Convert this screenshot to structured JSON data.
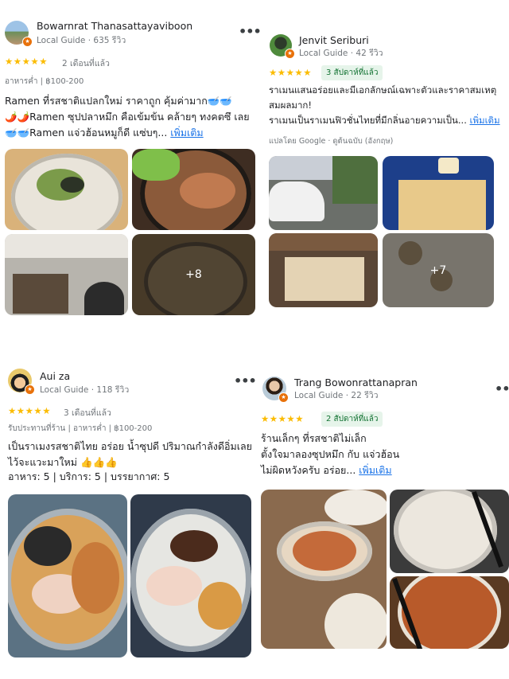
{
  "reviews": [
    {
      "name": "Bowarnrat Thanasattayaviboon",
      "guide": "Local Guide · 635 รีวิว",
      "when": "2 เดือนที่แล้ว",
      "meta": "อาหารค่ำ  |  ฿100-200",
      "lines": [
        "Ramen ที่รสชาติแปลกใหม่ ราคาถูก คุ้มค่ามาก🥣🥣",
        "🌶️🌶️Ramen ซุปปลาหมึก คือเข้มข้น คล้ายๆ ทงคตซึ เลย",
        "🥣🥣Ramen แจ่วฮ้อนหมูก็ดี แซ่บๆ..."
      ],
      "more": "เพิ่มเติม",
      "photo_count": "+8"
    },
    {
      "name": "Jenvit Seriburi",
      "guide": "Local Guide · 42 รีวิว",
      "when": "3 สัปดาห์ที่แล้ว",
      "lines": [
        "ราเมนแสนอร่อยและมีเอกลักษณ์เฉพาะตัวและราคาสมเหตุ",
        "สมผลมาก!",
        "ราเมนเป็นราเมนฟิวชั่นไทยที่มีกลิ่นอายความเป็น..."
      ],
      "more": "เพิ่มเติม",
      "translated": "แปลโดย Google · ดูต้นฉบับ (อังกฤษ)",
      "photo_count": "+7"
    },
    {
      "name": "Aui za",
      "guide": "Local Guide · 118 รีวิว",
      "when": "3 เดือนที่แล้ว",
      "meta": "รับประทานที่ร้าน  |  อาหารค่ำ  |  ฿100-200",
      "lines": [
        "เป็นราเมงรสชาติไทย อร่อย น้ำซุปดี ปริมาณกำลังดีอิ่มเลย",
        "ไว้จะแวะมาใหม่ 👍👍👍"
      ],
      "ratings": "อาหาร: 5 | บริการ: 5 | บรรยากาศ: 5"
    },
    {
      "name": "Trang Bowonrattanapran",
      "guide": "Local Guide · 22 รีวิว",
      "when": "2 สัปดาห์ที่แล้ว",
      "lines": [
        "ร้านเล็กๆ ที่รสชาติไม่เล็ก",
        "ตั้งใจมาลองซุปหมึก กับ แจ่วฮ้อน",
        "ไม่ผิดหวังครับ อร่อย..."
      ],
      "more": "เพิ่มเติม"
    }
  ],
  "stars": "★★★★★",
  "more_menu": "•••"
}
